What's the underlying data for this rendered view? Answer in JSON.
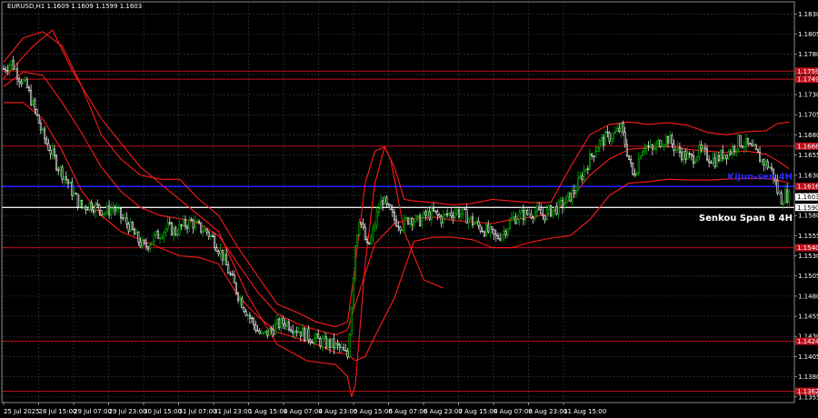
{
  "window_title": "EURUSD,H1  1.1609 1.1609 1.1599 1.1603",
  "colors": {
    "background": "#000000",
    "grid": "#33404a",
    "bull": "#00c000",
    "bear": "#ffffff",
    "indicator": "#ff1a1a",
    "level": "#c0101a",
    "kijun": "#2020ff",
    "senkou": "#e8e8e8",
    "text": "#ffffff"
  },
  "chart_data": {
    "type": "candlestick",
    "symbol": "EURUSD",
    "timeframe": "H1",
    "ohlc_header": {
      "open": "1.1609",
      "high": "1.1609",
      "low": "1.1599",
      "close": "1.1603"
    },
    "y_ticks": [
      "1.1830",
      "1.1805",
      "1.1780",
      "1.1755",
      "1.1730",
      "1.1705",
      "1.1680",
      "1.1655",
      "1.1630",
      "1.1605",
      "1.1580",
      "1.1555",
      "1.1530",
      "1.1505",
      "1.1480",
      "1.1455",
      "1.1430",
      "1.1405",
      "1.1380",
      "1.1355"
    ],
    "ylim": [
      1.1348,
      1.1845
    ],
    "x_ticks": [
      "25 Jul 2025",
      "28 Jul 15:00",
      "29 Jul 07:00",
      "29 Jul 23:00",
      "30 Jul 15:00",
      "31 Jul 07:00",
      "31 Jul 23:00",
      "1 Aug 15:00",
      "4 Aug 07:00",
      "4 Aug 23:00",
      "5 Aug 15:00",
      "6 Aug 07:00",
      "6 Aug 23:00",
      "7 Aug 15:00",
      "8 Aug 07:00",
      "8 Aug 23:00",
      "11 Aug 15:00"
    ],
    "horizontal_levels": [
      {
        "price": 1.1759,
        "label": "1.1759",
        "kind": "level"
      },
      {
        "price": 1.1749,
        "label": "1.1749",
        "kind": "level"
      },
      {
        "price": 1.1666,
        "label": "1.1666",
        "kind": "level"
      },
      {
        "price": 1.1616,
        "label": "1.1616",
        "kind": "kijun"
      },
      {
        "price": 1.159,
        "label": "1.1590",
        "kind": "senkou"
      },
      {
        "price": 1.154,
        "label": "1.1540",
        "kind": "level"
      },
      {
        "price": 1.1424,
        "label": "1.1424",
        "kind": "level"
      },
      {
        "price": 1.1362,
        "label": "1.1362",
        "kind": "level"
      }
    ],
    "current_price": {
      "price": 1.1603,
      "label": "1.1603"
    },
    "annotations": [
      {
        "text": "Kijun-sen 4H",
        "anchor_price": 1.162,
        "color": "#2a2aff"
      },
      {
        "text": "Senkou Span B 4H",
        "anchor_price": 1.158,
        "color": "#ffffff"
      }
    ],
    "close_path": [
      [
        0,
        1.1762
      ],
      [
        4,
        1.177
      ],
      [
        8,
        1.1752
      ],
      [
        12,
        1.1738
      ],
      [
        16,
        1.171
      ],
      [
        20,
        1.168
      ],
      [
        24,
        1.166
      ],
      [
        28,
        1.164
      ],
      [
        32,
        1.1625
      ],
      [
        36,
        1.1605
      ],
      [
        40,
        1.159
      ],
      [
        44,
        1.1594
      ],
      [
        48,
        1.159
      ],
      [
        52,
        1.1584
      ],
      [
        56,
        1.159
      ],
      [
        60,
        1.1578
      ],
      [
        64,
        1.1568
      ],
      [
        68,
        1.1552
      ],
      [
        72,
        1.154
      ],
      [
        76,
        1.155
      ],
      [
        80,
        1.1558
      ],
      [
        84,
        1.1565
      ],
      [
        88,
        1.156
      ],
      [
        92,
        1.1568
      ],
      [
        96,
        1.1572
      ],
      [
        100,
        1.1565
      ],
      [
        104,
        1.156
      ],
      [
        108,
        1.1548
      ],
      [
        112,
        1.153
      ],
      [
        116,
        1.1505
      ],
      [
        120,
        1.1482
      ],
      [
        124,
        1.1462
      ],
      [
        128,
        1.1445
      ],
      [
        132,
        1.143
      ],
      [
        136,
        1.1436
      ],
      [
        140,
        1.1444
      ],
      [
        144,
        1.1448
      ],
      [
        148,
        1.1442
      ],
      [
        152,
        1.1436
      ],
      [
        156,
        1.143
      ],
      [
        160,
        1.1426
      ],
      [
        164,
        1.1422
      ],
      [
        168,
        1.142
      ],
      [
        172,
        1.1415
      ],
      [
        176,
        1.1405
      ],
      [
        178,
        1.147
      ],
      [
        180,
        1.1545
      ],
      [
        182,
        1.1578
      ],
      [
        184,
        1.156
      ],
      [
        186,
        1.154
      ],
      [
        188,
        1.155
      ],
      [
        190,
        1.157
      ],
      [
        192,
        1.159
      ],
      [
        194,
        1.16
      ],
      [
        196,
        1.159
      ],
      [
        200,
        1.1575
      ],
      [
        204,
        1.1568
      ],
      [
        208,
        1.1578
      ],
      [
        212,
        1.1572
      ],
      [
        216,
        1.158
      ],
      [
        220,
        1.1583
      ],
      [
        224,
        1.1576
      ],
      [
        228,
        1.1582
      ],
      [
        232,
        1.1585
      ],
      [
        236,
        1.158
      ],
      [
        240,
        1.1572
      ],
      [
        244,
        1.1565
      ],
      [
        248,
        1.156
      ],
      [
        252,
        1.1552
      ],
      [
        256,
        1.156
      ],
      [
        260,
        1.1575
      ],
      [
        264,
        1.158
      ],
      [
        268,
        1.1582
      ],
      [
        272,
        1.1585
      ],
      [
        276,
        1.158
      ],
      [
        280,
        1.1586
      ],
      [
        284,
        1.159
      ],
      [
        288,
        1.1598
      ],
      [
        292,
        1.161
      ],
      [
        296,
        1.163
      ],
      [
        300,
        1.165
      ],
      [
        304,
        1.1668
      ],
      [
        308,
        1.1676
      ],
      [
        312,
        1.168
      ],
      [
        316,
        1.1688
      ],
      [
        318,
        1.167
      ],
      [
        320,
        1.165
      ],
      [
        322,
        1.163
      ],
      [
        324,
        1.164
      ],
      [
        326,
        1.166
      ],
      [
        328,
        1.1668
      ],
      [
        332,
        1.166
      ],
      [
        336,
        1.1672
      ],
      [
        340,
        1.1676
      ],
      [
        344,
        1.1662
      ],
      [
        348,
        1.1655
      ],
      [
        352,
        1.165
      ],
      [
        356,
        1.166
      ],
      [
        360,
        1.1654
      ],
      [
        364,
        1.1648
      ],
      [
        368,
        1.1656
      ],
      [
        372,
        1.166
      ],
      [
        376,
        1.1672
      ],
      [
        380,
        1.1668
      ],
      [
        384,
        1.166
      ],
      [
        388,
        1.1648
      ],
      [
        392,
        1.164
      ],
      [
        394,
        1.163
      ],
      [
        396,
        1.161
      ],
      [
        398,
        1.16
      ],
      [
        400,
        1.1606
      ],
      [
        402,
        1.1603
      ]
    ],
    "indicator_lines": {
      "upper_band": [
        [
          0,
          1.177
        ],
        [
          10,
          1.18
        ],
        [
          20,
          1.1808
        ],
        [
          30,
          1.179
        ],
        [
          40,
          1.174
        ],
        [
          50,
          1.168
        ],
        [
          60,
          1.165
        ],
        [
          70,
          1.163
        ],
        [
          80,
          1.1625
        ],
        [
          90,
          1.1625
        ],
        [
          100,
          1.16
        ],
        [
          110,
          1.158
        ],
        [
          120,
          1.154
        ],
        [
          130,
          1.1505
        ],
        [
          140,
          1.147
        ],
        [
          150,
          1.146
        ],
        [
          160,
          1.1448
        ],
        [
          170,
          1.1442
        ],
        [
          176,
          1.1448
        ],
        [
          180,
          1.152
        ],
        [
          185,
          1.162
        ],
        [
          190,
          1.166
        ],
        [
          195,
          1.1665
        ],
        [
          200,
          1.164
        ],
        [
          205,
          1.16
        ],
        [
          210,
          1.1598
        ],
        [
          220,
          1.1596
        ],
        [
          230,
          1.1593
        ],
        [
          240,
          1.1595
        ],
        [
          250,
          1.16
        ],
        [
          260,
          1.1598
        ],
        [
          270,
          1.1596
        ],
        [
          280,
          1.1596
        ],
        [
          290,
          1.164
        ],
        [
          300,
          1.168
        ],
        [
          310,
          1.1693
        ],
        [
          320,
          1.1696
        ],
        [
          330,
          1.1693
        ],
        [
          340,
          1.1695
        ],
        [
          350,
          1.1692
        ],
        [
          360,
          1.1683
        ],
        [
          370,
          1.168
        ],
        [
          380,
          1.1684
        ],
        [
          390,
          1.1685
        ],
        [
          396,
          1.1694
        ],
        [
          402,
          1.1696
        ]
      ],
      "middle": [
        [
          0,
          1.174
        ],
        [
          10,
          1.1758
        ],
        [
          20,
          1.1754
        ],
        [
          30,
          1.172
        ],
        [
          40,
          1.1682
        ],
        [
          50,
          1.164
        ],
        [
          60,
          1.161
        ],
        [
          70,
          1.159
        ],
        [
          80,
          1.158
        ],
        [
          90,
          1.1576
        ],
        [
          100,
          1.157
        ],
        [
          110,
          1.1555
        ],
        [
          120,
          1.152
        ],
        [
          130,
          1.1485
        ],
        [
          140,
          1.1458
        ],
        [
          150,
          1.1446
        ],
        [
          160,
          1.1438
        ],
        [
          170,
          1.1432
        ],
        [
          176,
          1.1438
        ],
        [
          180,
          1.147
        ],
        [
          190,
          1.1545
        ],
        [
          200,
          1.157
        ],
        [
          210,
          1.1576
        ],
        [
          220,
          1.1578
        ],
        [
          230,
          1.1574
        ],
        [
          240,
          1.1572
        ],
        [
          250,
          1.157
        ],
        [
          260,
          1.1575
        ],
        [
          270,
          1.1578
        ],
        [
          280,
          1.1582
        ],
        [
          290,
          1.16
        ],
        [
          300,
          1.163
        ],
        [
          310,
          1.165
        ],
        [
          320,
          1.1662
        ],
        [
          330,
          1.1664
        ],
        [
          340,
          1.1666
        ],
        [
          350,
          1.1662
        ],
        [
          360,
          1.166
        ],
        [
          370,
          1.1658
        ],
        [
          380,
          1.166
        ],
        [
          390,
          1.1656
        ],
        [
          396,
          1.1648
        ],
        [
          402,
          1.1638
        ]
      ],
      "lower_band": [
        [
          0,
          1.172
        ],
        [
          10,
          1.172
        ],
        [
          20,
          1.17
        ],
        [
          30,
          1.166
        ],
        [
          40,
          1.161
        ],
        [
          50,
          1.158
        ],
        [
          60,
          1.156
        ],
        [
          70,
          1.155
        ],
        [
          80,
          1.154
        ],
        [
          90,
          1.153
        ],
        [
          100,
          1.1528
        ],
        [
          110,
          1.152
        ],
        [
          120,
          1.148
        ],
        [
          130,
          1.1455
        ],
        [
          140,
          1.1435
        ],
        [
          150,
          1.1428
        ],
        [
          160,
          1.142
        ],
        [
          170,
          1.141
        ],
        [
          176,
          1.1408
        ],
        [
          180,
          1.14
        ],
        [
          185,
          1.1405
        ],
        [
          190,
          1.143
        ],
        [
          200,
          1.1478
        ],
        [
          210,
          1.1548
        ],
        [
          220,
          1.1553
        ],
        [
          230,
          1.1553
        ],
        [
          240,
          1.155
        ],
        [
          250,
          1.154
        ],
        [
          260,
          1.154
        ],
        [
          270,
          1.1547
        ],
        [
          280,
          1.1552
        ],
        [
          290,
          1.1555
        ],
        [
          300,
          1.1575
        ],
        [
          310,
          1.1605
        ],
        [
          320,
          1.162
        ],
        [
          330,
          1.1622
        ],
        [
          340,
          1.1625
        ],
        [
          350,
          1.1624
        ],
        [
          360,
          1.1624
        ],
        [
          370,
          1.1625
        ],
        [
          380,
          1.1626
        ],
        [
          390,
          1.1626
        ],
        [
          396,
          1.1624
        ],
        [
          402,
          1.162
        ]
      ]
    },
    "signal_line": [
      [
        0,
        1.175
      ],
      [
        15,
        1.179
      ],
      [
        25,
        1.181
      ],
      [
        35,
        1.176
      ],
      [
        50,
        1.17
      ],
      [
        70,
        1.164
      ],
      [
        90,
        1.16
      ],
      [
        110,
        1.156
      ],
      [
        125,
        1.148
      ],
      [
        140,
        1.142
      ],
      [
        155,
        1.14
      ],
      [
        170,
        1.1395
      ],
      [
        176,
        1.138
      ],
      [
        178,
        1.1355
      ],
      [
        180,
        1.137
      ],
      [
        185,
        1.152
      ],
      [
        190,
        1.162
      ],
      [
        195,
        1.1665
      ],
      [
        198,
        1.165
      ],
      [
        205,
        1.156
      ],
      [
        215,
        1.15
      ],
      [
        225,
        1.149
      ]
    ],
    "bars_count": 403
  }
}
